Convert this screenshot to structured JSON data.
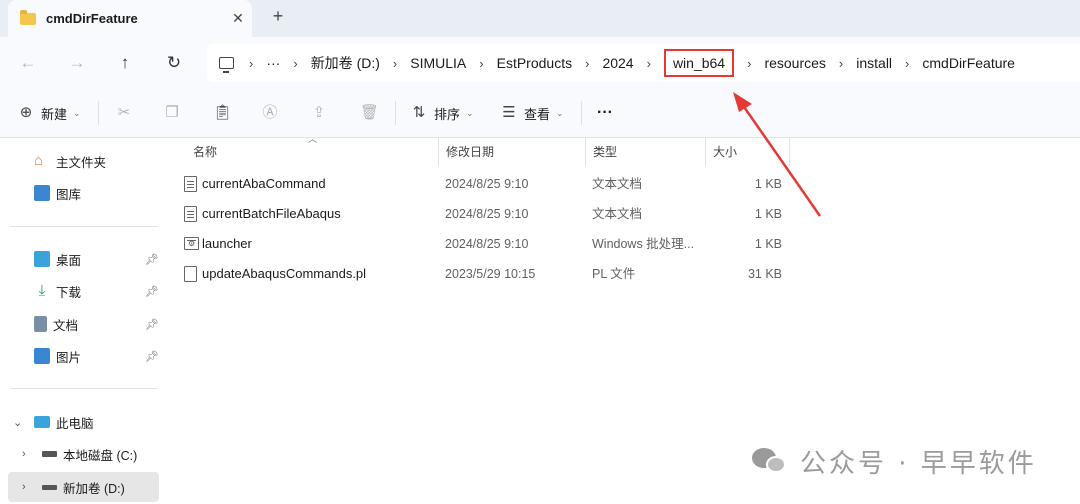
{
  "tab": {
    "title": "cmdDirFeature",
    "close": "✕",
    "new_tab": "+"
  },
  "nav": {
    "back": "←",
    "forward": "→",
    "up": "↑",
    "refresh": "↻"
  },
  "breadcrumb": {
    "more": "···",
    "items": [
      "新加卷 (D:)",
      "SIMULIA",
      "EstProducts",
      "2024",
      "win_b64",
      "resources",
      "install",
      "cmdDirFeature"
    ],
    "highlighted": "win_b64",
    "separator": "›"
  },
  "toolbar": {
    "new_label": "新建",
    "sort_label": "排序",
    "view_label": "查看",
    "more_label": "···"
  },
  "sidebar": {
    "home": "主文件夹",
    "gallery": "图库",
    "pinned": [
      {
        "label": "桌面"
      },
      {
        "label": "下载"
      },
      {
        "label": "文档"
      },
      {
        "label": "图片"
      }
    ],
    "this_pc": "此电脑",
    "drives": [
      {
        "label": "本地磁盘 (C:)"
      },
      {
        "label": "新加卷 (D:)"
      }
    ]
  },
  "columns": {
    "name": "名称",
    "modified": "修改日期",
    "type": "类型",
    "size": "大小"
  },
  "files": [
    {
      "name": "currentAbaCommand",
      "modified": "2024/8/25 9:10",
      "type": "文本文档",
      "size": "1 KB",
      "icon": "text-file-icon"
    },
    {
      "name": "currentBatchFileAbaqus",
      "modified": "2024/8/25 9:10",
      "type": "文本文档",
      "size": "1 KB",
      "icon": "text-file-icon"
    },
    {
      "name": "launcher",
      "modified": "2024/8/25 9:10",
      "type": "Windows 批处理...",
      "size": "1 KB",
      "icon": "batch-file-icon"
    },
    {
      "name": "updateAbaqusCommands.pl",
      "modified": "2023/5/29 10:15",
      "type": "PL 文件",
      "size": "31 KB",
      "icon": "blank-file-icon"
    }
  ],
  "watermark": {
    "text": "公众号 · 早早软件"
  },
  "colors": {
    "highlight": "#e53935",
    "tab_bg": "#e9eef5",
    "chrome_bg": "#f8fafd",
    "selected_bg": "#e6e6e6"
  }
}
